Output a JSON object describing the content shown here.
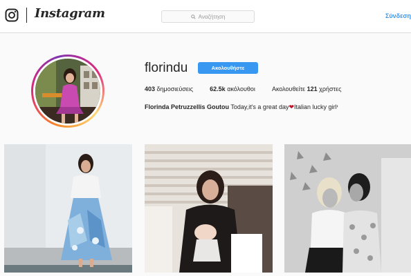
{
  "header": {
    "logo_icon": "instagram-icon",
    "wordmark": "Instagram",
    "search_placeholder": "Αναζήτηση",
    "search_icon": "search-icon",
    "login_label": "Σύνδεση",
    "login_color": "#3897f0"
  },
  "profile": {
    "username": "florindu",
    "follow_label": "Ακολουθήστε",
    "follow_color": "#3897f0",
    "posts_count": "403",
    "posts_label": "δημοσιεύσεις",
    "followers_count": "62.5k",
    "followers_label": "ακόλουθοι",
    "following_prefix": "Ακολουθείτε",
    "following_count": "121",
    "following_suffix": "χρήστες",
    "full_name": "Florinda Petruzzellis Goutou",
    "bio_part1": "Today,it's a great day",
    "bio_heart": "❤",
    "bio_part2": "Italian lucky girlי"
  },
  "posts": [
    {
      "content": "woman-in-floral-skirt-photo"
    },
    {
      "content": "mother-holding-baby-photo"
    },
    {
      "content": "two-women-black-and-white-photo"
    }
  ]
}
